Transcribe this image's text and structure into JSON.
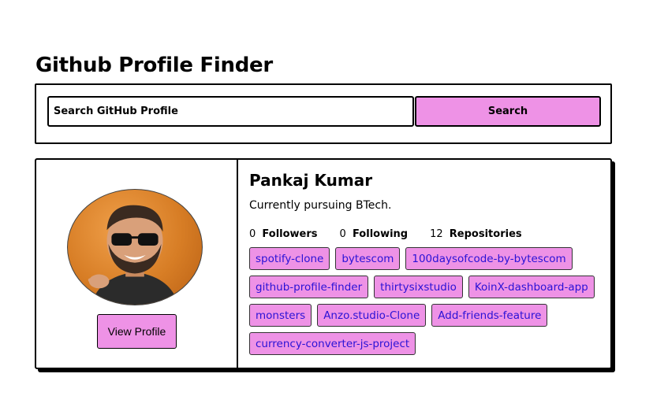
{
  "header": {
    "title": "Github Profile Finder"
  },
  "search": {
    "placeholder": "Search GitHub Profile",
    "value": "",
    "button_label": "Search"
  },
  "profile": {
    "name": "Pankaj Kumar",
    "bio": "Currently pursuing BTech.",
    "view_profile_label": "View Profile",
    "stats": [
      {
        "count": "0",
        "label": "Followers"
      },
      {
        "count": "0",
        "label": "Following"
      },
      {
        "count": "12",
        "label": "Repositories"
      }
    ],
    "repositories": [
      "spotify-clone",
      "bytescom",
      "100daysofcode-by-bytescom",
      "github-profile-finder",
      "thirtysixstudio",
      "KoinX-dashboard-app",
      "monsters",
      "Anzo.studio-Clone",
      "Add-friends-feature",
      "currency-converter-js-project"
    ]
  },
  "colors": {
    "accent": "#ee92e6",
    "link": "#2a12d6",
    "border": "#000000"
  }
}
